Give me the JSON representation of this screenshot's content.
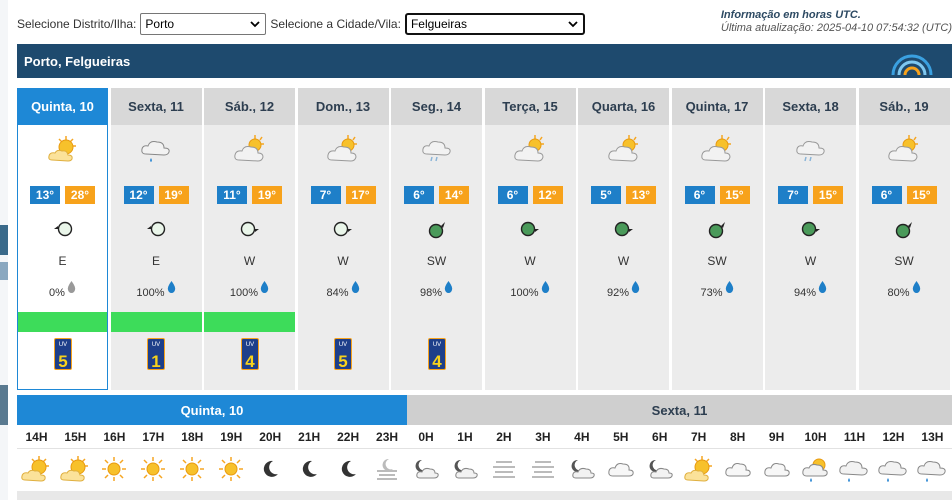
{
  "selectors": {
    "district_label": "Selecione Distrito/Ilha:",
    "district_value": "Porto",
    "city_label": "Selecione a Cidade/Vila:",
    "city_value": "Felgueiras"
  },
  "info": {
    "title": "Informação em horas UTC.",
    "updated": "Última atualização: 2025-04-10 07:54:32 (UTC)"
  },
  "location": "Porto, Felgueiras",
  "colors": {
    "header": "#1e4a6e",
    "active": "#1e88d6",
    "tmin": "#1e7fc8",
    "tmax": "#f7a21b",
    "warning": "#3ddc5a"
  },
  "days": [
    {
      "name": "Quinta, 10",
      "icon": "sun-cloud-icon",
      "tmin": "13°",
      "tmax": "28°",
      "wind_icon": "wind-arrow-west-icon",
      "wind_dir": "E",
      "precip": "0%",
      "drop_icon": "grey-drop-icon",
      "warning": true,
      "uv": "5"
    },
    {
      "name": "Sexta, 11",
      "icon": "cloud-rain-icon",
      "tmin": "12°",
      "tmax": "19°",
      "wind_icon": "wind-arrow-west-icon",
      "wind_dir": "E",
      "precip": "100%",
      "drop_icon": "blue-drop-icon",
      "warning": true,
      "uv": "1"
    },
    {
      "name": "Sáb., 12",
      "icon": "cloud-sun-icon",
      "tmin": "11°",
      "tmax": "19°",
      "wind_icon": "wind-arrow-east-icon",
      "wind_dir": "W",
      "precip": "100%",
      "drop_icon": "blue-drop-icon",
      "warning": true,
      "uv": "4"
    },
    {
      "name": "Dom., 13",
      "icon": "cloud-sun-icon",
      "tmin": "7°",
      "tmax": "17°",
      "wind_icon": "wind-arrow-east-icon",
      "wind_dir": "W",
      "precip": "84%",
      "drop_icon": "blue-drop-icon",
      "warning": false,
      "uv": "5"
    },
    {
      "name": "Seg., 14",
      "icon": "cloud-drizzle-icon",
      "tmin": "6°",
      "tmax": "14°",
      "wind_icon": "wind-arrow-northeast-icon",
      "wind_dir": "SW",
      "precip": "98%",
      "drop_icon": "blue-drop-icon",
      "warning": false,
      "uv": "4"
    },
    {
      "name": "Terça, 15",
      "icon": "cloud-sun-icon",
      "tmin": "6°",
      "tmax": "12°",
      "wind_icon": "wind-arrow-east-icon",
      "wind_dir": "W",
      "precip": "100%",
      "drop_icon": "blue-drop-icon",
      "warning": false,
      "uv": ""
    },
    {
      "name": "Quarta, 16",
      "icon": "cloud-sun-icon",
      "tmin": "5°",
      "tmax": "13°",
      "wind_icon": "wind-arrow-east-icon",
      "wind_dir": "W",
      "precip": "92%",
      "drop_icon": "blue-drop-icon",
      "warning": false,
      "uv": ""
    },
    {
      "name": "Quinta, 17",
      "icon": "cloud-sun-icon",
      "tmin": "6°",
      "tmax": "15°",
      "wind_icon": "wind-arrow-northeast-icon",
      "wind_dir": "SW",
      "precip": "73%",
      "drop_icon": "blue-drop-icon",
      "warning": false,
      "uv": ""
    },
    {
      "name": "Sexta, 18",
      "icon": "cloud-drizzle-icon",
      "tmin": "7°",
      "tmax": "15°",
      "wind_icon": "wind-arrow-east-icon",
      "wind_dir": "W",
      "precip": "94%",
      "drop_icon": "blue-drop-icon",
      "warning": false,
      "uv": ""
    },
    {
      "name": "Sáb., 19",
      "icon": "cloud-sun-icon",
      "tmin": "6°",
      "tmax": "15°",
      "wind_icon": "wind-arrow-northeast-icon",
      "wind_dir": "SW",
      "precip": "80%",
      "drop_icon": "blue-drop-icon",
      "warning": false,
      "uv": ""
    }
  ],
  "hourly": {
    "day1": "Quinta, 10",
    "day2": "Sexta, 11",
    "hours": [
      "14H",
      "15H",
      "16H",
      "17H",
      "18H",
      "19H",
      "20H",
      "21H",
      "22H",
      "23H",
      "0H",
      "1H",
      "2H",
      "3H",
      "4H",
      "5H",
      "6H",
      "7H",
      "8H",
      "9H",
      "10H",
      "11H",
      "12H",
      "13H"
    ],
    "icons": [
      "sun-cloud-icon",
      "sun-cloud-icon",
      "sun-icon",
      "sun-icon",
      "sun-icon",
      "sun-icon",
      "moon-icon",
      "moon-icon",
      "moon-icon",
      "moon-fog-icon",
      "moon-cloud-icon",
      "moon-cloud-icon",
      "fog-icon",
      "fog-icon",
      "moon-cloud-icon",
      "cloud-icon",
      "moon-cloud-icon",
      "sun-cloud-icon",
      "cloud-icon",
      "cloud-icon",
      "sun-cloud-rain-icon",
      "cloud-rain-icon",
      "cloud-rain-icon",
      "cloud-rain-icon"
    ]
  }
}
